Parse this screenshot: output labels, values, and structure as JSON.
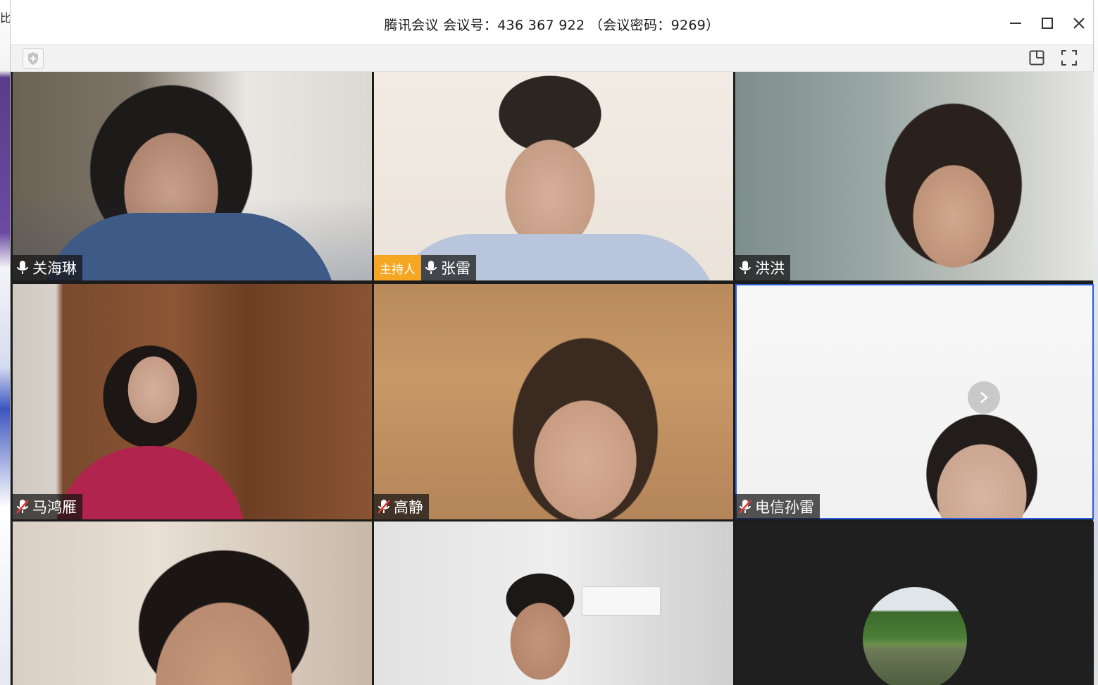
{
  "window": {
    "title": "腾讯会议 会议号：436 367 922 （会议密码：9269）"
  },
  "desktop": {
    "left_glyph": "比"
  },
  "toolbar": {
    "security_icon": "shield-icon",
    "layout_icon": "layout-icon",
    "fullscreen_icon": "fullscreen-icon"
  },
  "host_label": "主持人",
  "participants": [
    {
      "name": "关海琳",
      "mic": "on"
    },
    {
      "name": "张雷",
      "mic": "on",
      "host": true
    },
    {
      "name": "洪洪",
      "mic": "on"
    },
    {
      "name": "马鸿雁",
      "mic": "off"
    },
    {
      "name": "高静",
      "mic": "off"
    },
    {
      "name": "电信孙雷",
      "mic": "off",
      "selected": true
    },
    {
      "name": "",
      "mic": "none"
    },
    {
      "name": "",
      "mic": "none"
    },
    {
      "name": "",
      "mic": "none",
      "avatar": true
    }
  ],
  "colors": {
    "host_badge": "#f5a623",
    "selected_border": "#2b5fd9",
    "name_chip_bg": "#141414"
  }
}
